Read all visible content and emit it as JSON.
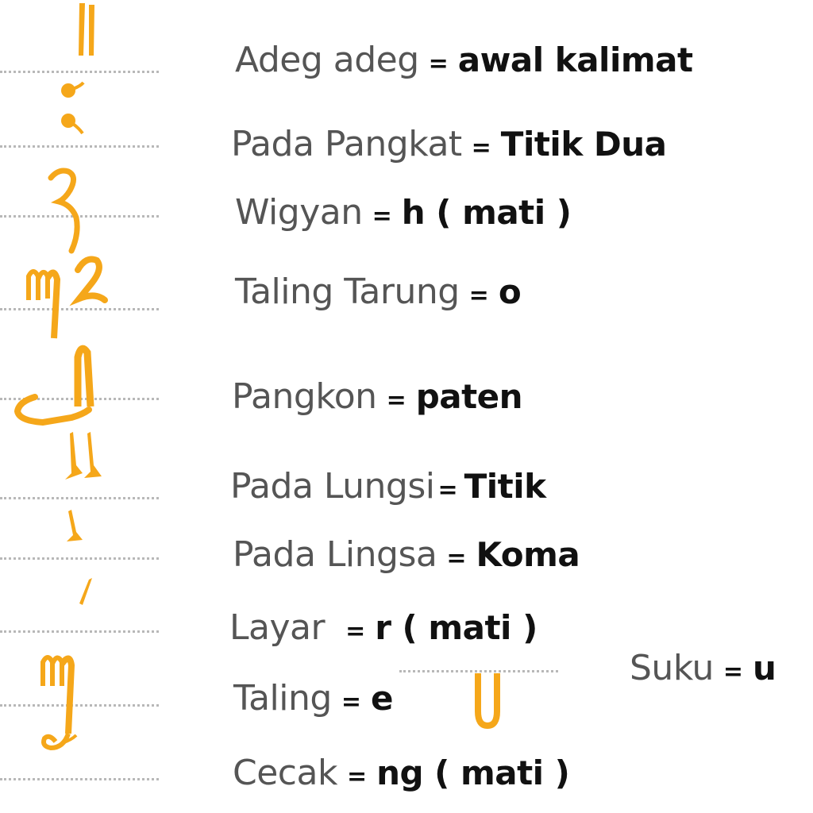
{
  "accent_color": "#F5A71A",
  "entries": [
    {
      "id": "adeg-adeg",
      "term": "Adeg adeg",
      "eq": "=",
      "value": "awal kalimat",
      "icon": "adeg-adeg-glyph-icon"
    },
    {
      "id": "pada-pangkat",
      "term": "Pada Pangkat",
      "eq": "=",
      "value": "Titik Dua",
      "icon": "pada-pangkat-glyph-icon"
    },
    {
      "id": "wigyan",
      "term": "Wigyan",
      "eq": "=",
      "value": "h ( mati )",
      "icon": "wigyan-glyph-icon"
    },
    {
      "id": "taling-tarung",
      "term": "Taling Tarung",
      "eq": "=",
      "value": "o",
      "icon": "taling-tarung-glyph-icon"
    },
    {
      "id": "pangkon",
      "term": "Pangkon",
      "eq": "=",
      "value": "paten",
      "icon": "pangkon-glyph-icon"
    },
    {
      "id": "pada-lungsi",
      "term": "Pada Lungsi",
      "eq": "=",
      "value": "Titik",
      "icon": "pada-lungsi-glyph-icon"
    },
    {
      "id": "pada-lingsa",
      "term": "Pada Lingsa",
      "eq": "=",
      "value": "Koma",
      "icon": "pada-lingsa-glyph-icon"
    },
    {
      "id": "layar",
      "term": "Layar",
      "eq": "=",
      "value": "r ( mati )",
      "icon": "layar-glyph-icon"
    },
    {
      "id": "taling",
      "term": "Taling",
      "eq": "=",
      "value": "e",
      "icon": "taling-glyph-icon"
    },
    {
      "id": "cecak",
      "term": "Cecak",
      "eq": "=",
      "value": "ng ( mati )",
      "icon": "cecak-glyph-icon"
    }
  ],
  "suku": {
    "term": "Suku",
    "eq": "=",
    "value": "u",
    "icon": "suku-glyph-icon"
  }
}
